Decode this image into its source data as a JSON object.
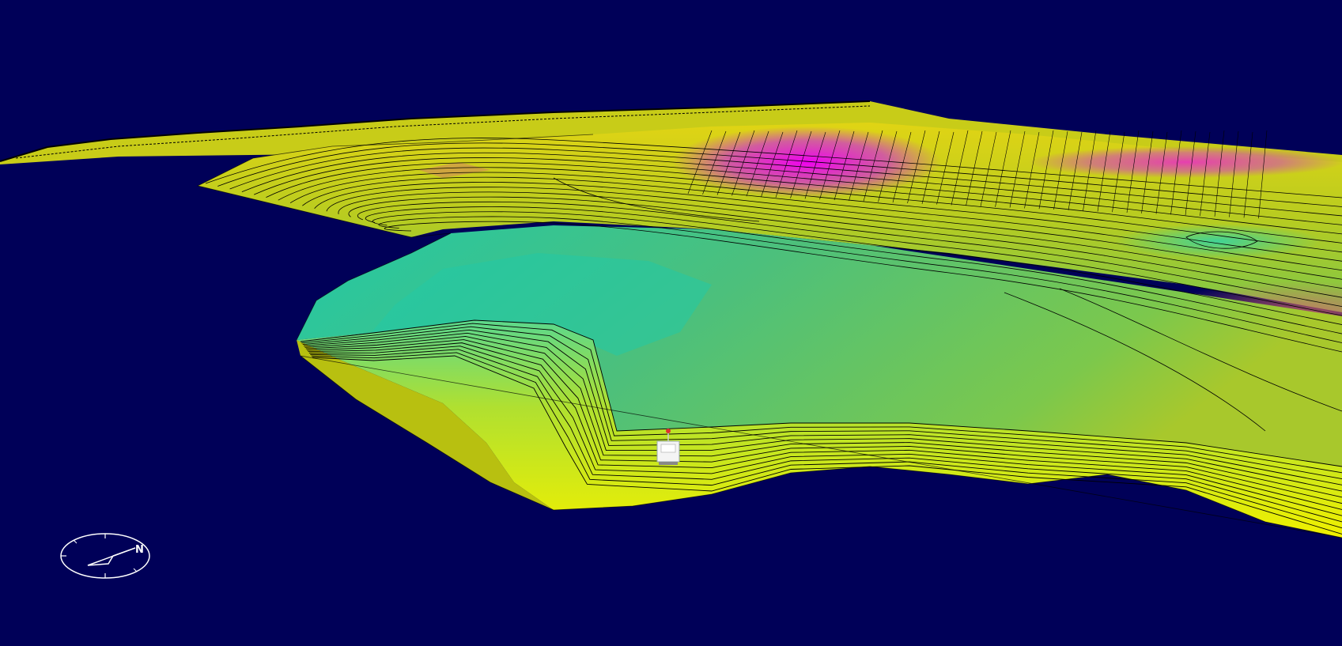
{
  "viewport": {
    "background": "#000058",
    "kind": "3d-bathymetric-terrain-view"
  },
  "terrain": {
    "color_ramp": [
      "#f0f000",
      "#c8c810",
      "#8ccc3c",
      "#5cc46c",
      "#22c8a6",
      "#3ae8c8",
      "#d06868",
      "#f000f0"
    ],
    "contour_color": "#000000",
    "contour_lines": true
  },
  "vessel": {
    "icon": "boat-icon",
    "colors": {
      "hull": "#f4f4f4",
      "marker": "#e03030"
    }
  },
  "compass": {
    "icon": "compass-icon",
    "north_label": "N",
    "color": "#ffffff"
  }
}
